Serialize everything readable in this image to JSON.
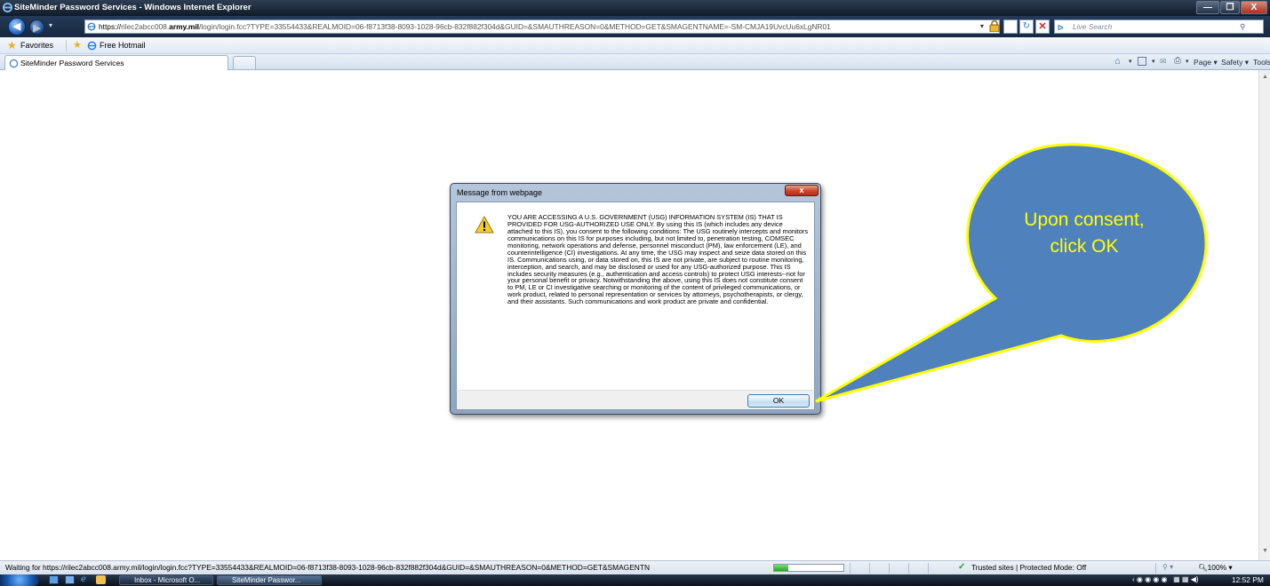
{
  "window": {
    "title": "SiteMinder Password Services - Windows Internet Explorer",
    "min_label": "—",
    "max_label": "❐",
    "close_label": "X"
  },
  "address": {
    "protocol": "https://",
    "domain_pre": "rilec2abcc008.",
    "domain": "army.mil",
    "path": "/login/login.fcc?TYPE=33554433&REALMOID=06-f8713f38-8093-1028-96cb-832f882f304d&GUID=&SMAUTHREASON=0&METHOD=GET&SMAGENTNAME=-SM-CMJA19UvcUu6xLgNR01",
    "search_placeholder": "Live Search"
  },
  "favorites": {
    "favorites_label": "Favorites",
    "free_hotmail_label": "Free Hotmail"
  },
  "tab": {
    "label": "SiteMinder Password Services"
  },
  "commandbar": {
    "page_label": "Page ▾",
    "safety_label": "Safety ▾",
    "tools_label": "Tools ▾"
  },
  "dialog": {
    "title": "Message from webpage",
    "close_label": "x",
    "message": "YOU ARE ACCESSING A U.S. GOVERNMENT (USG) INFORMATION SYSTEM (IS) THAT IS PROVIDED FOR USG-AUTHORIZED USE ONLY. By using this IS (which includes any device attached to this IS), you consent to the following conditions: The USG routinely intercepts and monitors communications on this IS for purposes including, but not limited to, penetration testing, COMSEC monitoring, network operations and defense, personnel misconduct (PM), law enforcement (LE), and counterintelligence (CI) investigations. At any time, the USG may inspect and seize data stored on this IS. Communications using, or data stored on, this IS are not private, are subject to routine monitoring, interception, and search, and may be disclosed or used for any USG-authorized purpose. This IS includes security measures (e.g., authentication and access controls) to protect USG interests--not for your personal benefit or privacy. Notwithstanding the above, using this IS does not constitute consent to PM, LE or CI investigative searching or monitoring of the content of privileged communications, or work product, related to personal representation or services by attorneys, psychotherapists, or clergy, and their assistants. Such communications and work product are private and confidential.",
    "ok_label": "OK"
  },
  "callout": {
    "text": "Upon consent, click OK",
    "fill": "#4f81bd",
    "border": "#ffff00",
    "text_color": "#ffff00"
  },
  "status": {
    "text": "Waiting for https://rilec2abcc008.army.mil/login/login.fcc?TYPE=33554433&REALMOID=06-f8713f38-8093-1028-96cb-832f882f304d&GUID=&SMAUTHREASON=0&METHOD=GET&SMAGENTN",
    "progress": 0.2,
    "zone": "Trusted sites | Protected Mode: Off",
    "zoom": "100%"
  },
  "taskbar": {
    "items": [
      "Inbox - Microsoft O...",
      "SiteMinder Passwor..."
    ],
    "clock": "12:52 PM"
  }
}
